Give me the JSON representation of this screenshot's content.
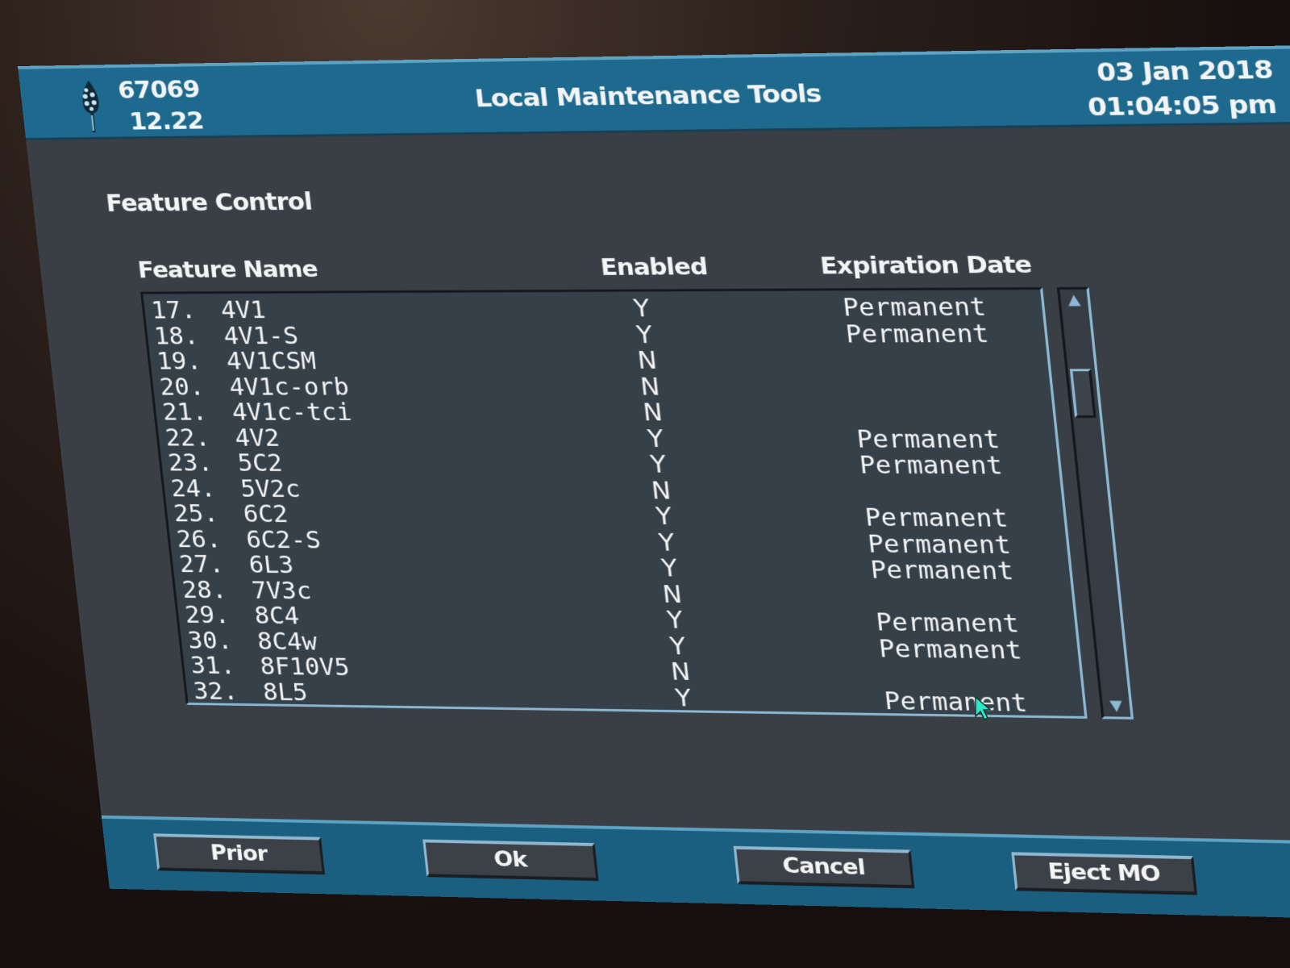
{
  "header": {
    "system_id": "67069",
    "version": "12.22",
    "title": "Local Maintenance Tools",
    "date": "03 Jan 2018",
    "time": "01:04:05 pm",
    "logo_icon": "tree-icon"
  },
  "section": {
    "title": "Feature Control"
  },
  "table": {
    "columns": [
      "Feature Name",
      "Enabled",
      "Expiration Date"
    ],
    "rows": [
      {
        "num": "17.",
        "name": "4V1",
        "enabled": "Y",
        "expiration": "Permanent"
      },
      {
        "num": "18.",
        "name": "4V1-S",
        "enabled": "Y",
        "expiration": "Permanent"
      },
      {
        "num": "19.",
        "name": "4V1CSM",
        "enabled": "N",
        "expiration": ""
      },
      {
        "num": "20.",
        "name": "4V1c-orb",
        "enabled": "N",
        "expiration": ""
      },
      {
        "num": "21.",
        "name": "4V1c-tci",
        "enabled": "N",
        "expiration": ""
      },
      {
        "num": "22.",
        "name": "4V2",
        "enabled": "Y",
        "expiration": "Permanent"
      },
      {
        "num": "23.",
        "name": "5C2",
        "enabled": "Y",
        "expiration": "Permanent"
      },
      {
        "num": "24.",
        "name": "5V2c",
        "enabled": "N",
        "expiration": ""
      },
      {
        "num": "25.",
        "name": "6C2",
        "enabled": "Y",
        "expiration": "Permanent"
      },
      {
        "num": "26.",
        "name": "6C2-S",
        "enabled": "Y",
        "expiration": "Permanent"
      },
      {
        "num": "27.",
        "name": "6L3",
        "enabled": "Y",
        "expiration": "Permanent"
      },
      {
        "num": "28.",
        "name": "7V3c",
        "enabled": "N",
        "expiration": ""
      },
      {
        "num": "29.",
        "name": "8C4",
        "enabled": "Y",
        "expiration": "Permanent"
      },
      {
        "num": "30.",
        "name": "8C4w",
        "enabled": "Y",
        "expiration": "Permanent"
      },
      {
        "num": "31.",
        "name": "8F10V5",
        "enabled": "N",
        "expiration": ""
      },
      {
        "num": "32.",
        "name": "8L5",
        "enabled": "Y",
        "expiration": "Permanent"
      }
    ]
  },
  "scrollbar": {
    "up_icon": "arrow-up-icon",
    "down_icon": "arrow-down-icon",
    "position_fraction": 0.17
  },
  "buttons": {
    "prior": "Prior",
    "ok": "Ok",
    "cancel": "Cancel",
    "eject": "Eject MO"
  },
  "colors": {
    "title_bar": "#1d6a8e",
    "panel_bg": "#3a3f45",
    "list_bg": "#354049",
    "accent_border": "#8db8d4",
    "cursor": "#2ee6c8"
  }
}
